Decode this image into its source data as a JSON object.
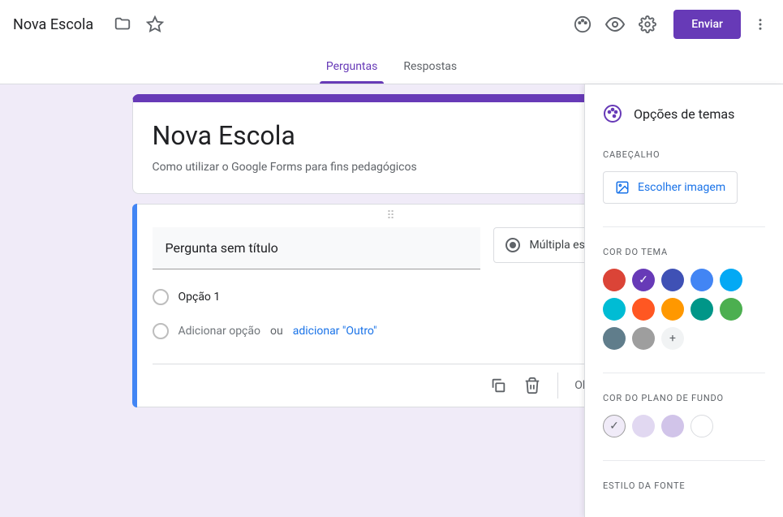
{
  "header": {
    "title": "Nova Escola",
    "send": "Enviar"
  },
  "tabs": {
    "questions": "Perguntas",
    "responses": "Respostas"
  },
  "form": {
    "title": "Nova Escola",
    "description": "Como utilizar o Google Forms para fins pedagógicos"
  },
  "question": {
    "text": "Pergunta sem título",
    "type": "Múltipla escolha",
    "option1": "Opção 1",
    "addOption": "Adicionar opção",
    "or": "ou",
    "addOther": "adicionar \"Outro\"",
    "required": "Obrigatória"
  },
  "theme": {
    "title": "Opções de temas",
    "headerLabel": "Cabeçalho",
    "chooseImage": "Escolher imagem",
    "themeColorLabel": "Cor do tema",
    "themeColors": [
      "#db4437",
      "#673ab7",
      "#3f51b5",
      "#4285f4",
      "#03a9f4",
      "#00bcd4",
      "#ff5722",
      "#ff9800",
      "#009688",
      "#4caf50",
      "#607d8b",
      "#9e9e9e"
    ],
    "selectedThemeIndex": 1,
    "bgColorLabel": "Cor do plano de fundo",
    "bgColors": [
      "#f0ebf8",
      "#e1d8f1",
      "#d1c4e9",
      "#ffffff"
    ],
    "selectedBgIndex": 0,
    "fontLabel": "Estilo da fonte"
  }
}
